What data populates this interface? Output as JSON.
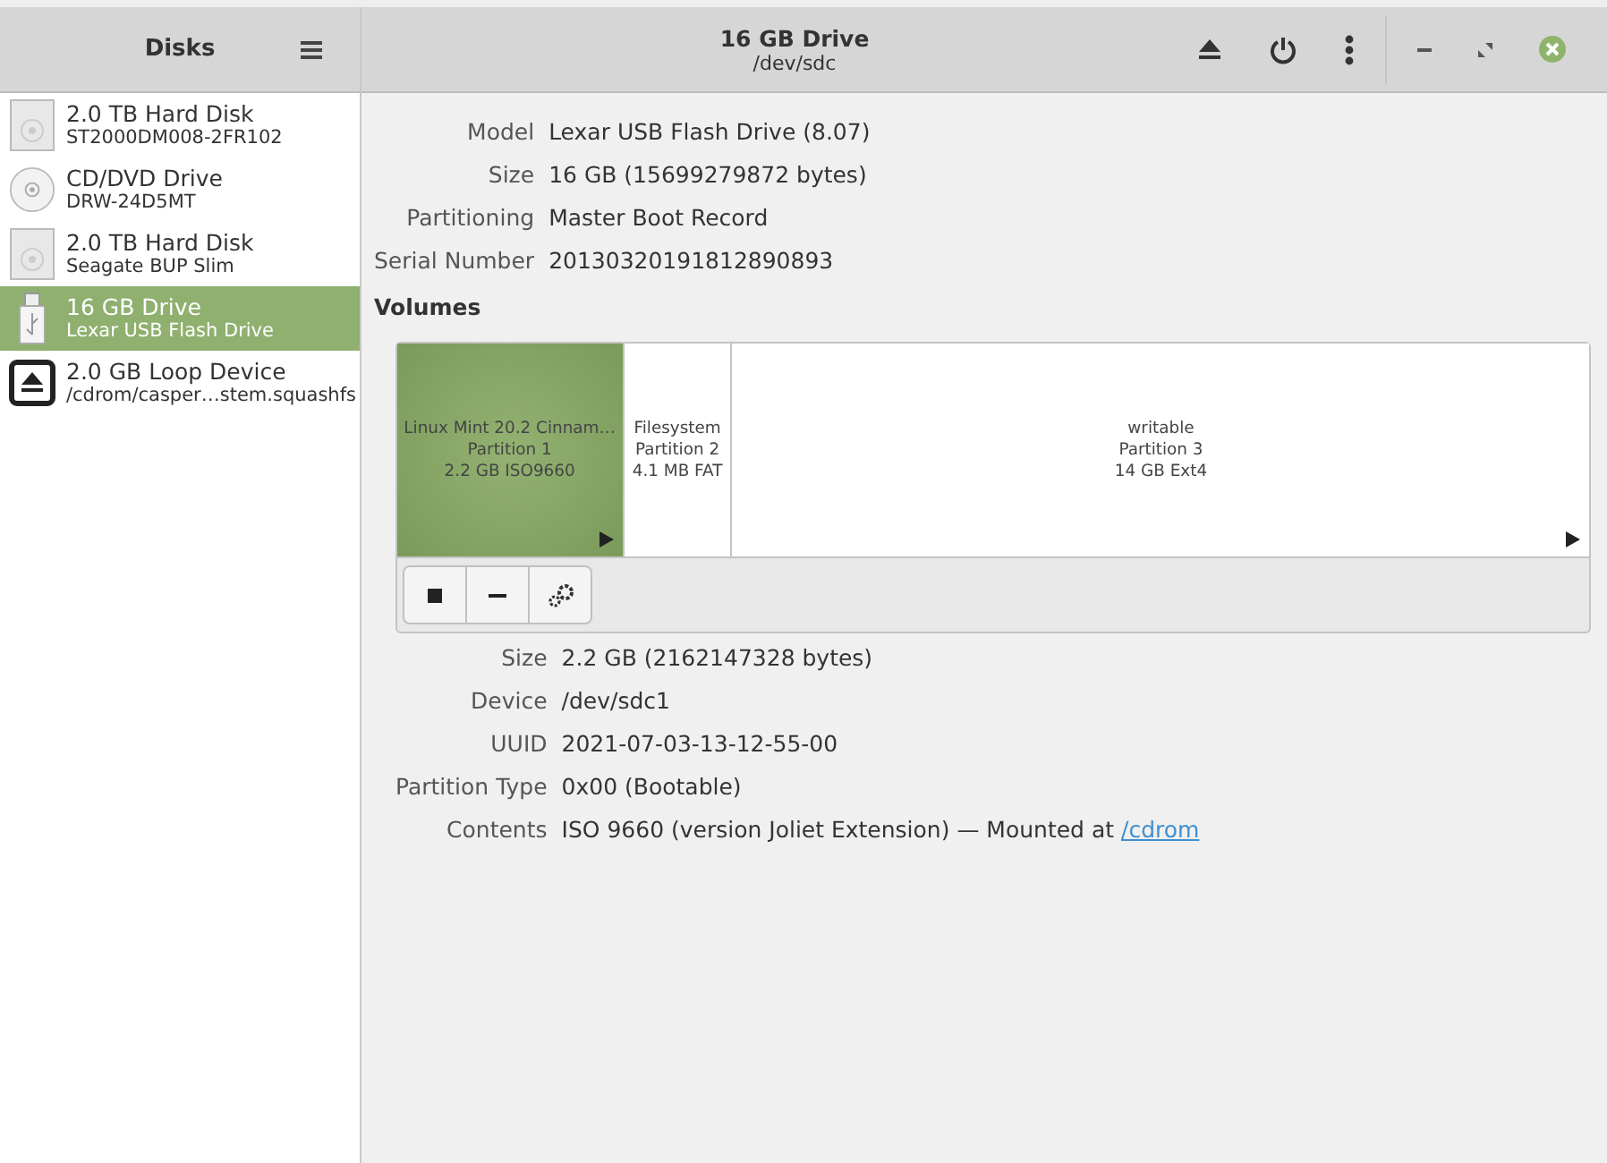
{
  "sidebar": {
    "title": "Disks",
    "items": [
      {
        "kind": "hdd",
        "name": "2.0 TB Hard Disk",
        "detail": "ST2000DM008-2FR102",
        "selected": false
      },
      {
        "kind": "optical",
        "name": "CD/DVD Drive",
        "detail": "DRW-24D5MT",
        "selected": false
      },
      {
        "kind": "hdd",
        "name": "2.0 TB Hard Disk",
        "detail": "Seagate BUP Slim",
        "selected": false
      },
      {
        "kind": "usb",
        "name": "16 GB Drive",
        "detail": "Lexar USB Flash Drive",
        "selected": true
      },
      {
        "kind": "loop",
        "name": "2.0 GB Loop Device",
        "detail": "/cdrom/casper…stem.squashfs",
        "selected": false
      }
    ]
  },
  "header": {
    "title": "16 GB Drive",
    "subtitle": "/dev/sdc"
  },
  "drive_info": [
    {
      "label": "Model",
      "value": "Lexar USB Flash Drive (8.07)"
    },
    {
      "label": "Size",
      "value": "16 GB (15699279872 bytes)"
    },
    {
      "label": "Partitioning",
      "value": "Master Boot Record"
    },
    {
      "label": "Serial Number",
      "value": "20130320191812890893"
    }
  ],
  "volumes": {
    "title": "Volumes",
    "partitions": [
      {
        "lines": [
          "Linux Mint 20.2 Cinnam…",
          "Partition 1",
          "2.2 GB ISO9660"
        ],
        "selected": true,
        "mounted": true
      },
      {
        "lines": [
          "Filesystem",
          "Partition 2",
          "4.1 MB FAT"
        ],
        "selected": false,
        "mounted": false
      },
      {
        "lines": [
          "writable",
          "Partition 3",
          "14 GB Ext4"
        ],
        "selected": false,
        "mounted": true
      }
    ]
  },
  "volume_info": [
    {
      "label": "Size",
      "value": "2.2 GB (2162147328 bytes)"
    },
    {
      "label": "Device",
      "value": "/dev/sdc1"
    },
    {
      "label": "UUID",
      "value": "2021-07-03-13-12-55-00"
    },
    {
      "label": "Partition Type",
      "value": "0x00 (Bootable)"
    },
    {
      "label": "Contents",
      "value": "ISO 9660 (version Joliet Extension) — Mounted at ",
      "link": "/cdrom"
    }
  ]
}
